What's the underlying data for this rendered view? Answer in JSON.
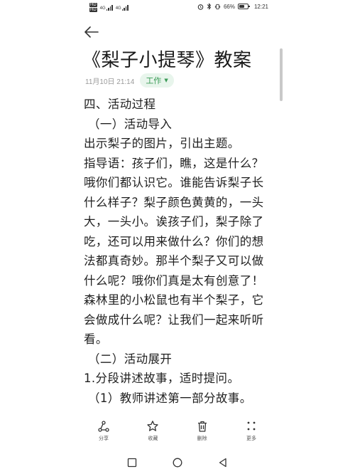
{
  "status_bar": {
    "sim1": "HD",
    "sim2": "HD",
    "net1": "4G",
    "net2": "4G",
    "battery_text": "66%",
    "battery_level": 0.66,
    "time": "12:21"
  },
  "note": {
    "title": "《梨子小提琴》教案",
    "date": "11月10日 21:14",
    "category": "工作",
    "lines": [
      "四、活动过程",
      "（一）活动导入",
      "出示梨子的图片，引出主题。",
      "指导语：孩子们，瞧，这是什么？",
      "哦你们都认识它。谁能告诉梨子长",
      "什么样子？梨子颜色黄黄的，一头",
      "大，一头小。诶孩子们，梨子除了",
      "吃，还可以用来做什么？你们的想",
      "法都真奇妙。那半个梨子又可以做",
      "什么呢？哦你们真是太有创意了！",
      "森林里的小松鼠也有半个梨子，它",
      "会做成什么呢？让我们一起来听听",
      "看。",
      "（二）活动展开",
      "1.分段讲述故事，适时提问。",
      "（1）教师讲述第一部分故事。"
    ]
  },
  "toolbar": {
    "share": "分享",
    "favorite": "收藏",
    "delete": "删除",
    "more": "更多"
  }
}
